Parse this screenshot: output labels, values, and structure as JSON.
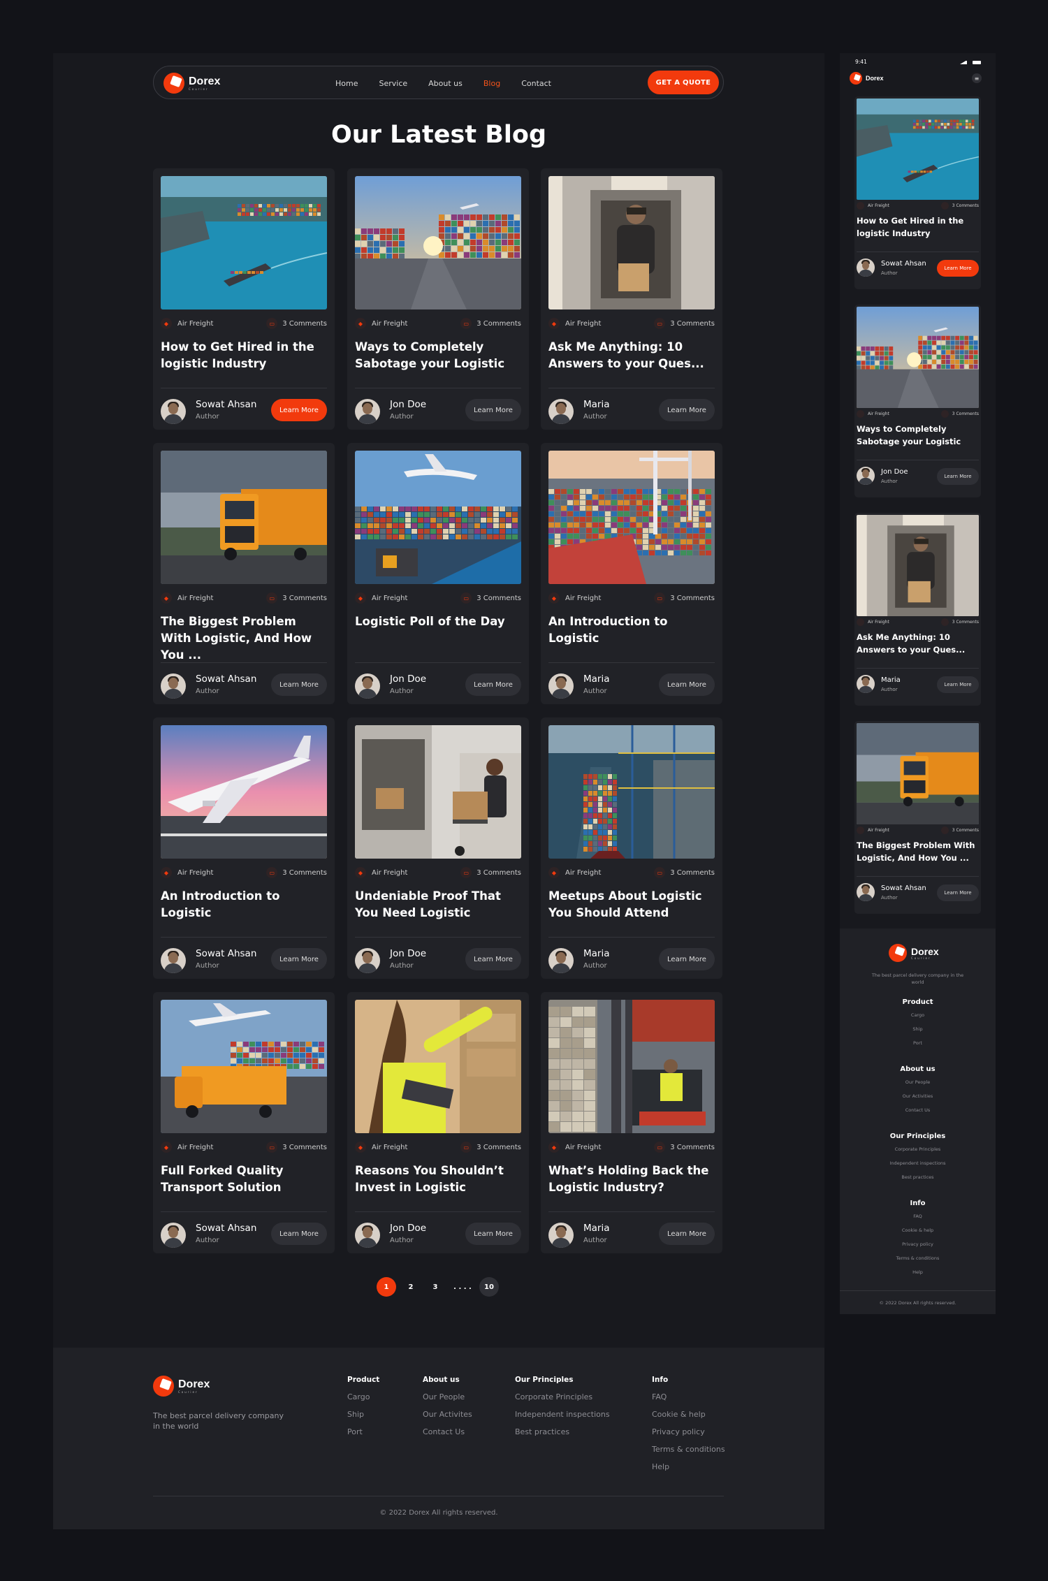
{
  "nav": {
    "brand": "Dorex",
    "brand_sub": "Courier",
    "links": [
      "Home",
      "Service",
      "About us",
      "Blog",
      "Contact"
    ],
    "active": "Blog",
    "cta": "GET A QUOTE"
  },
  "page_title": "Our Latest Blog",
  "posts": [
    {
      "category": "Air Freight",
      "comments": "3 Comments",
      "title": "How to Get Hired in the logistic Industry",
      "author": "Sowat Ahsan",
      "role": "Author",
      "button": "Learn More",
      "highlight": true,
      "scene": "port"
    },
    {
      "category": "Air Freight",
      "comments": "3 Comments",
      "title": "Ways to Completely Sabotage your Logistic",
      "author": "Jon Doe",
      "role": "Author",
      "button": "Learn More",
      "highlight": false,
      "scene": "containers"
    },
    {
      "category": "Air Freight",
      "comments": "3 Comments",
      "title": "Ask Me Anything: 10 Answers to your Ques...",
      "author": "Maria",
      "role": "Author",
      "button": "Learn More",
      "highlight": false,
      "scene": "van"
    },
    {
      "category": "Air Freight",
      "comments": "3 Comments",
      "title": "The Biggest Problem With Logistic, And How You ...",
      "author": "Sowat Ahsan",
      "role": "Author",
      "button": "Learn More",
      "highlight": false,
      "scene": "truck"
    },
    {
      "category": "Air Freight",
      "comments": "3 Comments",
      "title": "Logistic Poll of the Day",
      "author": "Jon Doe",
      "role": "Author",
      "button": "Learn More",
      "highlight": false,
      "scene": "plane-ship"
    },
    {
      "category": "Air Freight",
      "comments": "3 Comments",
      "title": "An Introduction to Logistic",
      "author": "Maria",
      "role": "Author",
      "button": "Learn More",
      "highlight": false,
      "scene": "terminal"
    },
    {
      "category": "Air Freight",
      "comments": "3 Comments",
      "title": "An Introduction to Logistic",
      "author": "Sowat Ahsan",
      "role": "Author",
      "button": "Learn More",
      "highlight": false,
      "scene": "airplane"
    },
    {
      "category": "Air Freight",
      "comments": "3 Comments",
      "title": "Undeniable Proof That You Need Logistic",
      "author": "Jon Doe",
      "role": "Author",
      "button": "Learn More",
      "highlight": false,
      "scene": "delivery"
    },
    {
      "category": "Air Freight",
      "comments": "3 Comments",
      "title": "Meetups About Logistic You Should Attend",
      "author": "Maria",
      "role": "Author",
      "button": "Learn More",
      "highlight": false,
      "scene": "aerial"
    },
    {
      "category": "Air Freight",
      "comments": "3 Comments",
      "title": "Full Forked Quality Transport Solution",
      "author": "Sowat Ahsan",
      "role": "Author",
      "button": "Learn More",
      "highlight": false,
      "scene": "combo"
    },
    {
      "category": "Air Freight",
      "comments": "3 Comments",
      "title": "Reasons You Shouldn’t Invest in Logistic",
      "author": "Jon Doe",
      "role": "Author",
      "button": "Learn More",
      "highlight": false,
      "scene": "worker"
    },
    {
      "category": "Air Freight",
      "comments": "3 Comments",
      "title": "What’s Holding Back the Logistic Industry?",
      "author": "Maria",
      "role": "Author",
      "button": "Learn More",
      "highlight": false,
      "scene": "forklift"
    }
  ],
  "pagination": {
    "pages": [
      "1",
      "2",
      "3"
    ],
    "ellipsis": ". . . .",
    "last": "10",
    "current": "1"
  },
  "footer": {
    "tagline": "The best parcel delivery company in the world",
    "columns": [
      {
        "heading": "Product",
        "links": [
          "Cargo",
          "Ship",
          "Port"
        ]
      },
      {
        "heading": "About us",
        "links": [
          "Our People",
          "Our Activites",
          "Contact Us"
        ]
      },
      {
        "heading": "Our Principles",
        "links": [
          "Corporate Principles",
          "Independent inspections",
          "Best practices"
        ]
      },
      {
        "heading": "Info",
        "links": [
          "FAQ",
          "Cookie & help",
          "Privacy policy",
          "Terms & conditions",
          "Help"
        ]
      }
    ],
    "copyright": "© 2022 Dorex All rights reserved."
  },
  "mobile": {
    "time": "9:41",
    "brand": "Dorex",
    "post_indexes": [
      0,
      1,
      2,
      3
    ],
    "footer_columns": [
      {
        "heading": "Product",
        "links": [
          "Cargo",
          "Ship",
          "Port"
        ]
      },
      {
        "heading": "About us",
        "links": [
          "Our People",
          "Our Activities",
          "Contact Us"
        ]
      },
      {
        "heading": "Our Principles",
        "links": [
          "Corporate Principles",
          "Independent inspections",
          "Best practices"
        ]
      },
      {
        "heading": "Info",
        "links": [
          "FAQ",
          "Cookie & help",
          "Privacy policy",
          "Terms & conditions",
          "Help"
        ]
      }
    ],
    "copyright": "© 2022 Dorex All rights reserved."
  },
  "colors": {
    "accent": "#f23a0d",
    "background": "#121318",
    "panel": "#18191e",
    "card": "#212227"
  }
}
